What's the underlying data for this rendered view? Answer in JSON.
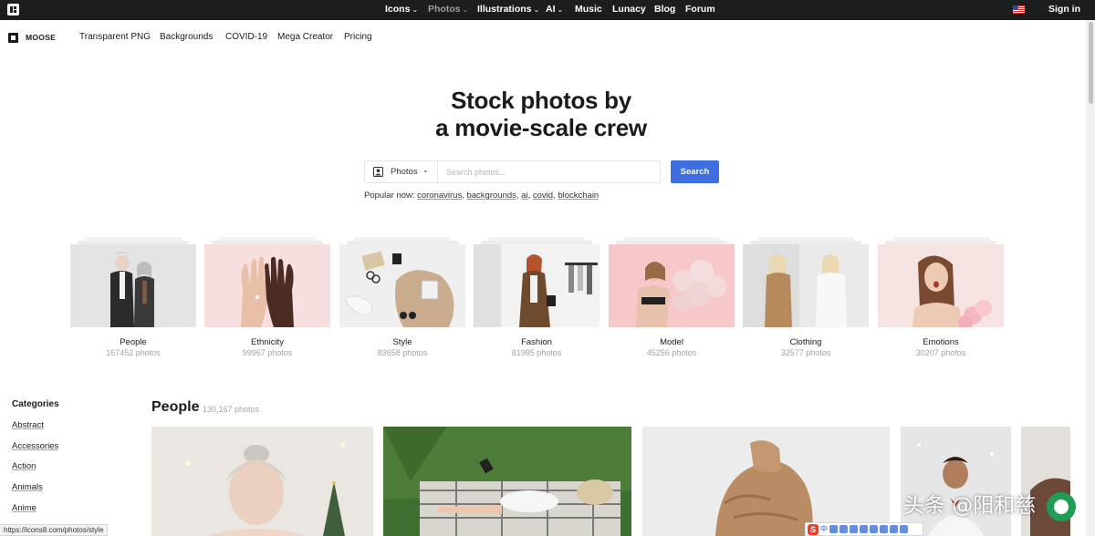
{
  "topbar": {
    "nav": [
      {
        "label": "Icons",
        "dropdown": true,
        "active": false
      },
      {
        "label": "Photos",
        "dropdown": true,
        "active": true
      },
      {
        "label": "Illustrations",
        "dropdown": true,
        "active": false
      },
      {
        "label": "AI",
        "dropdown": true,
        "active": false
      },
      {
        "label": "Music",
        "dropdown": false,
        "active": false
      },
      {
        "label": "Lunacy",
        "dropdown": false,
        "active": false
      },
      {
        "label": "Blog",
        "dropdown": false,
        "active": false
      },
      {
        "label": "Forum",
        "dropdown": false,
        "active": false
      }
    ],
    "signin": "Sign in",
    "language_flag_icon": "us-flag-icon"
  },
  "subnav": {
    "brand": "MOOSE",
    "links": [
      "Transparent PNG",
      "Backgrounds",
      "COVID-19",
      "Mega Creator",
      "Pricing"
    ]
  },
  "hero": {
    "title_line1": "Stock photos by",
    "title_line2": "a movie-scale crew"
  },
  "search": {
    "type_label": "Photos",
    "placeholder": "Search photos...",
    "button": "Search",
    "popular_label": "Popular now:",
    "popular_terms": [
      "coronavirus",
      "backgrounds",
      "ai",
      "covid",
      "blockchain"
    ]
  },
  "categories_cards": [
    {
      "name": "People",
      "count": "167452 photos"
    },
    {
      "name": "Ethnicity",
      "count": "99967 photos"
    },
    {
      "name": "Style",
      "count": "83658 photos"
    },
    {
      "name": "Fashion",
      "count": "81985 photos"
    },
    {
      "name": "Model",
      "count": "45256 photos"
    },
    {
      "name": "Clothing",
      "count": "32577 photos"
    },
    {
      "name": "Emotions",
      "count": "30207 photos"
    }
  ],
  "sidebar": {
    "heading": "Categories",
    "items": [
      "Abstract",
      "Accessories",
      "Action",
      "Animals",
      "Anime"
    ]
  },
  "section": {
    "title": "People",
    "count": "130,167 photos"
  },
  "status_url": "https://icons8.com/photos/style",
  "watermark": "头条 @阳和慈",
  "ime": {
    "label": "中"
  },
  "colors": {
    "topbar_bg": "#1b1d1f",
    "accent": "#3d6fe0"
  }
}
